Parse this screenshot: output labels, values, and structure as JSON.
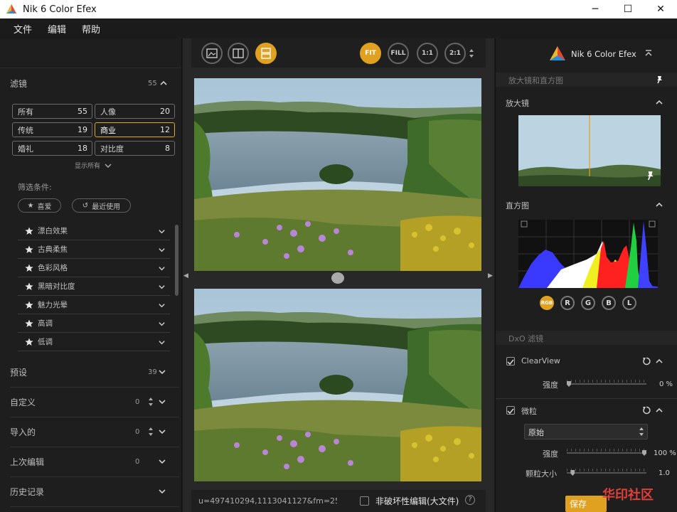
{
  "window": {
    "title": "Nik 6 Color Efex",
    "minimize": "─",
    "maximize": "☐",
    "close": "✕"
  },
  "menu": [
    "文件",
    "编辑",
    "帮助"
  ],
  "left": {
    "filters_header": {
      "label": "滤镜",
      "count": "55"
    },
    "filter_buttons": [
      {
        "label": "所有",
        "count": "55"
      },
      {
        "label": "人像",
        "count": "20"
      },
      {
        "label": "传统",
        "count": "19"
      },
      {
        "label": "商业",
        "count": "12",
        "selected": true
      },
      {
        "label": "婚礼",
        "count": "18"
      },
      {
        "label": "对比度",
        "count": "8"
      }
    ],
    "show_all": "显示所有",
    "filter_conditions": "筛选条件:",
    "favorites": "喜爱",
    "recent": "最近使用",
    "filter_list": [
      "漂白效果",
      "古典柔焦",
      "色彩风格",
      "黑暗对比度",
      "魅力光晕",
      "高调",
      "低调"
    ],
    "sections": [
      {
        "label": "预设",
        "count": "39"
      },
      {
        "label": "自定义",
        "count": "0"
      },
      {
        "label": "导入的",
        "count": "0"
      },
      {
        "label": "上次编辑",
        "count": "0"
      },
      {
        "label": "历史记录",
        "count": ""
      }
    ]
  },
  "center": {
    "zoom": [
      "FIT",
      "FILL",
      "1:1",
      "2:1"
    ],
    "active_zoom": "FIT",
    "url": "u=497410294,1113041127&fm=253...",
    "nondestructive": "非破坏性编辑(大文件)",
    "help": "?"
  },
  "right": {
    "app_title": "Nik 6 Color Efex",
    "loupe_section": "放大镜和直方图",
    "loupe": "放大镜",
    "histogram": "直方图",
    "channels": [
      "RGB",
      "R",
      "G",
      "B",
      "L"
    ],
    "active_channel": "RGB",
    "dxo_section": "DxO 滤镜",
    "clearview": {
      "label": "ClearView",
      "strength_label": "强度",
      "strength_value": "0 %",
      "strength": 0
    },
    "grain": {
      "label": "微粒",
      "preset": "原始",
      "strength_label": "强度",
      "strength_value": "100 %",
      "strength": 1.0,
      "size_label": "颗粒大小",
      "size_value": "1.0",
      "size": 0.05
    },
    "save": "保存",
    "watermark": "华印社区"
  },
  "colors": {
    "accent": "#e0a020"
  }
}
